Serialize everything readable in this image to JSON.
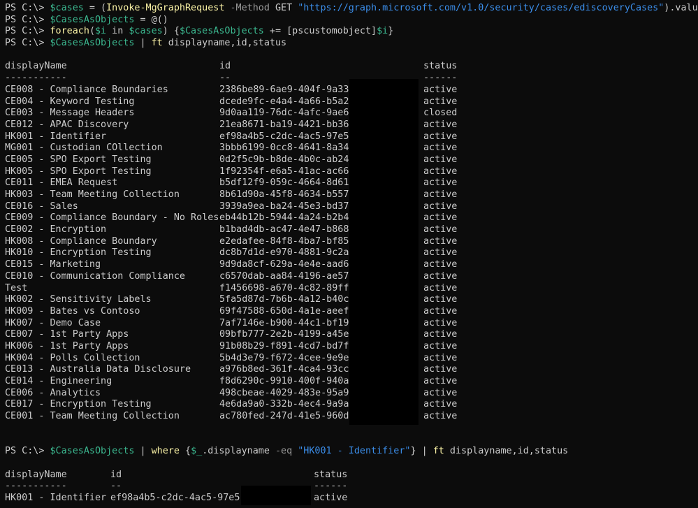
{
  "prompt": "PS C:\\>",
  "commands": [
    {
      "parts": [
        {
          "t": " ",
          "c": "c-default"
        },
        {
          "t": "$cases",
          "c": "c-var"
        },
        {
          "t": " = (",
          "c": "c-default"
        },
        {
          "t": "Invoke-MgGraphRequest",
          "c": "c-cmd"
        },
        {
          "t": " -Method ",
          "c": "c-param"
        },
        {
          "t": "GET ",
          "c": "c-default"
        },
        {
          "t": "\"https://graph.microsoft.com/v1.0/security/cases/ediscoveryCases\"",
          "c": "c-str"
        },
        {
          "t": ").value",
          "c": "c-default"
        }
      ]
    },
    {
      "parts": [
        {
          "t": " ",
          "c": "c-default"
        },
        {
          "t": "$CasesAsObjects",
          "c": "c-var"
        },
        {
          "t": " = @()",
          "c": "c-default"
        }
      ]
    },
    {
      "parts": [
        {
          "t": " ",
          "c": "c-default"
        },
        {
          "t": "foreach",
          "c": "c-cmd"
        },
        {
          "t": "(",
          "c": "c-default"
        },
        {
          "t": "$i",
          "c": "c-var"
        },
        {
          "t": " in ",
          "c": "c-default"
        },
        {
          "t": "$cases",
          "c": "c-var"
        },
        {
          "t": ") {",
          "c": "c-default"
        },
        {
          "t": "$CasesAsObjects",
          "c": "c-var"
        },
        {
          "t": " += [pscustomobject]",
          "c": "c-default"
        },
        {
          "t": "$i",
          "c": "c-var"
        },
        {
          "t": "}",
          "c": "c-default"
        }
      ]
    },
    {
      "parts": [
        {
          "t": " ",
          "c": "c-default"
        },
        {
          "t": "$CasesAsObjects",
          "c": "c-var"
        },
        {
          "t": " | ",
          "c": "c-default"
        },
        {
          "t": "ft",
          "c": "c-cmd"
        },
        {
          "t": " displayname,id,status",
          "c": "c-default"
        }
      ]
    }
  ],
  "table1": {
    "headers": [
      "displayName",
      "id",
      "status"
    ],
    "underlines": [
      "-----------",
      "--",
      "------"
    ],
    "rows": [
      [
        "CE008 - Compliance Boundaries",
        "2386be89-6ae9-404f-9a33-",
        "active"
      ],
      [
        "CE004 - Keyword Testing",
        "dcede9fc-e4a4-4a66-b5a2-",
        "active"
      ],
      [
        "CE003 - Message Headers",
        "9d0aa119-76dc-4afc-9ae6-",
        "closed"
      ],
      [
        "CE012 - APAC Discovery",
        "21ea8671-ba19-4421-bb36-",
        "active"
      ],
      [
        "HK001 - Identifier",
        "ef98a4b5-c2dc-4ac5-97e5-",
        "active"
      ],
      [
        "MG001 - Custodian COllection",
        "3bbb6199-0cc8-4641-8a34-",
        "active"
      ],
      [
        "CE005 - SPO Export Testing",
        "0d2f5c9b-b8de-4b0c-ab24-",
        "active"
      ],
      [
        "HK005 - SPO Export Testing",
        "1f92354f-e6a5-41ac-ac66-",
        "active"
      ],
      [
        "CE011 - EMEA Request",
        "b5df12f9-059c-4664-8d61-",
        "active"
      ],
      [
        "HK003 - Team Meeting Collection",
        "8b61d90a-45f8-4634-b557-",
        "active"
      ],
      [
        "CE016 - Sales",
        "3939a9ea-ba24-45e3-bd37-",
        "active"
      ],
      [
        "CE009 - Compliance Boundary - No Roles",
        "eb44b12b-5944-4a24-b2b4-",
        "active"
      ],
      [
        "CE002 - Encryption",
        "b1bad4db-ac47-4e47-b868-",
        "active"
      ],
      [
        "HK008 - Compliance Boundary",
        "e2edafee-84f8-4ba7-bf85-",
        "active"
      ],
      [
        "HK010 - Encryption Testing",
        "dc8b7d1d-e970-4881-9c2a-",
        "active"
      ],
      [
        "CE015 - Marketing",
        "9d9da8cf-629a-4e4e-aad6-",
        "active"
      ],
      [
        "CE010 - Communication Compliance",
        "c6570dab-aa84-4196-ae57-",
        "active"
      ],
      [
        "Test",
        "f1456698-a670-4c82-89ff-",
        "active"
      ],
      [
        "HK002 - Sensitivity Labels",
        "5fa5d87d-7b6b-4a12-b40c-",
        "active"
      ],
      [
        "HK009 - Bates vs Contoso",
        "69f47588-650d-4a1e-aeef-",
        "active"
      ],
      [
        "HK007 - Demo Case",
        "7af7146e-b900-44c1-bf19-",
        "active"
      ],
      [
        "CE007 - 1st Party Apps",
        "09bfb777-2e2b-4199-a45e-",
        "active"
      ],
      [
        "HK006 - 1st Party Apps",
        "91b08b29-f891-4cd7-bd7f-",
        "active"
      ],
      [
        "HK004 - Polls Collection",
        "5b4d3e79-f672-4cee-9e9e-",
        "active"
      ],
      [
        "CE013 - Australia Data Disclosure",
        "a976b8ed-361f-4ca4-93cc-",
        "active"
      ],
      [
        "CE014 - Engineering",
        "f8d6290c-9910-400f-940a-",
        "active"
      ],
      [
        "CE006 - Analytics",
        "498cbeae-4029-483e-95a9-",
        "active"
      ],
      [
        "CE017 - Encryption Testing",
        "4e6da9a0-332b-4ec4-9a9a-",
        "active"
      ],
      [
        "CE001 - Team Meeting Collection",
        "ac780fed-247d-41e5-960d-",
        "active"
      ]
    ]
  },
  "command2": {
    "parts": [
      {
        "t": " ",
        "c": "c-default"
      },
      {
        "t": "$CasesAsObjects",
        "c": "c-var"
      },
      {
        "t": " | ",
        "c": "c-default"
      },
      {
        "t": "where",
        "c": "c-cmd"
      },
      {
        "t": " {",
        "c": "c-default"
      },
      {
        "t": "$_",
        "c": "c-var"
      },
      {
        "t": ".displayname ",
        "c": "c-default"
      },
      {
        "t": "-eq",
        "c": "c-param"
      },
      {
        "t": " ",
        "c": "c-default"
      },
      {
        "t": "\"HK001 - Identifier\"",
        "c": "c-str"
      },
      {
        "t": "} | ",
        "c": "c-default"
      },
      {
        "t": "ft",
        "c": "c-cmd"
      },
      {
        "t": " displayname,id,status",
        "c": "c-default"
      }
    ]
  },
  "table2": {
    "headers": [
      "displayName",
      "id",
      "status"
    ],
    "underlines": [
      "-----------",
      "--",
      "------"
    ],
    "rows": [
      [
        "HK001 - Identifier",
        "ef98a4b5-c2dc-4ac5-97e5-",
        "active"
      ]
    ]
  }
}
